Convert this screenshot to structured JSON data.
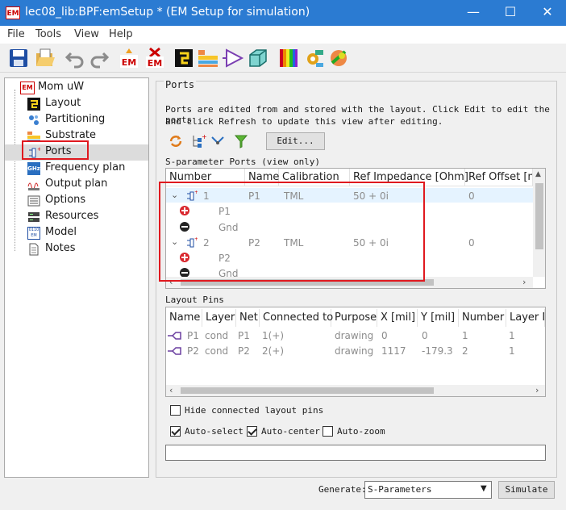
{
  "window": {
    "title": "lec08_lib:BPF:emSetup * (EM Setup for simulation)",
    "app_badge": "EM",
    "controls": [
      "—",
      "☐",
      "✕"
    ]
  },
  "menu": [
    "File",
    "Tools",
    "View",
    "Help"
  ],
  "toolbar": {
    "items": [
      "save-icon",
      "open-icon",
      "undo-icon",
      "redo-icon",
      "em-simulate-icon",
      "em-stop-icon",
      "layout-view-icon",
      "substrate-icon",
      "symbol-icon",
      "3d-view-icon",
      "spectrum-icon",
      "settings-gear-icon",
      "far-field-icon"
    ],
    "em_label": "EM"
  },
  "tree": {
    "root": "Mom uW",
    "root_badge": "EM",
    "items": [
      {
        "label": "Layout",
        "icon": "layout-icon"
      },
      {
        "label": "Partitioning",
        "icon": "partitioning-icon"
      },
      {
        "label": "Substrate",
        "icon": "substrate-icon"
      },
      {
        "label": "Ports",
        "icon": "ports-icon",
        "selected": true
      },
      {
        "label": "Frequency plan",
        "icon": "frequency-icon",
        "badge": "GHz"
      },
      {
        "label": "Output plan",
        "icon": "output-plan-icon"
      },
      {
        "label": "Options",
        "icon": "options-icon"
      },
      {
        "label": "Resources",
        "icon": "resources-icon"
      },
      {
        "label": "Model",
        "icon": "model-icon",
        "badge": "0110 EM"
      },
      {
        "label": "Notes",
        "icon": "notes-icon"
      }
    ]
  },
  "ports_panel": {
    "group_title": "Ports",
    "description_line1": "Ports are edited from and stored with the layout. Click Edit to edit the ports",
    "description_line2": "and click Refresh to update this view after editing.",
    "edit_button": "Edit...",
    "sparam_title": "S-parameter Ports (view only)",
    "sparam_columns": [
      "Number",
      "Name",
      "Calibration",
      "Ref Impedance [Ohm]",
      "Ref Offset [m"
    ],
    "sparam_rows": [
      {
        "number": "1",
        "name": "P1",
        "calibration": "TML",
        "impedance": "50 + 0i",
        "offset": "0",
        "plus": "P1",
        "minus": "Gnd"
      },
      {
        "number": "2",
        "name": "P2",
        "calibration": "TML",
        "impedance": "50 + 0i",
        "offset": "0",
        "plus": "P2",
        "minus": "Gnd"
      }
    ],
    "layout_pins_title": "Layout Pins",
    "pin_columns": [
      "Name",
      "Layer",
      "Net",
      "Connected to",
      "Purpose",
      "X [mil]",
      "Y [mil]",
      "Number",
      "Layer N"
    ],
    "pin_rows": [
      {
        "name": "P1",
        "layer": "cond",
        "net": "P1",
        "connected": "1(+)",
        "purpose": "drawing",
        "x": "0",
        "y": "0",
        "number": "1",
        "layer_n": "1"
      },
      {
        "name": "P2",
        "layer": "cond",
        "net": "P2",
        "connected": "2(+)",
        "purpose": "drawing",
        "x": "1117",
        "y": "-179.3",
        "number": "2",
        "layer_n": "1"
      }
    ],
    "hide_connected": "Hide connected layout pins",
    "auto_select": "Auto-select",
    "auto_center": "Auto-center",
    "auto_zoom": "Auto-zoom",
    "status_value": ""
  },
  "footer": {
    "generate_label": "Generate:",
    "generate_value": "S-Parameters",
    "simulate_button": "Simulate"
  },
  "colors": {
    "titlebar": "#2b7bd2",
    "highlight": "#e0191f",
    "selected_row": "#dcdcdc"
  }
}
